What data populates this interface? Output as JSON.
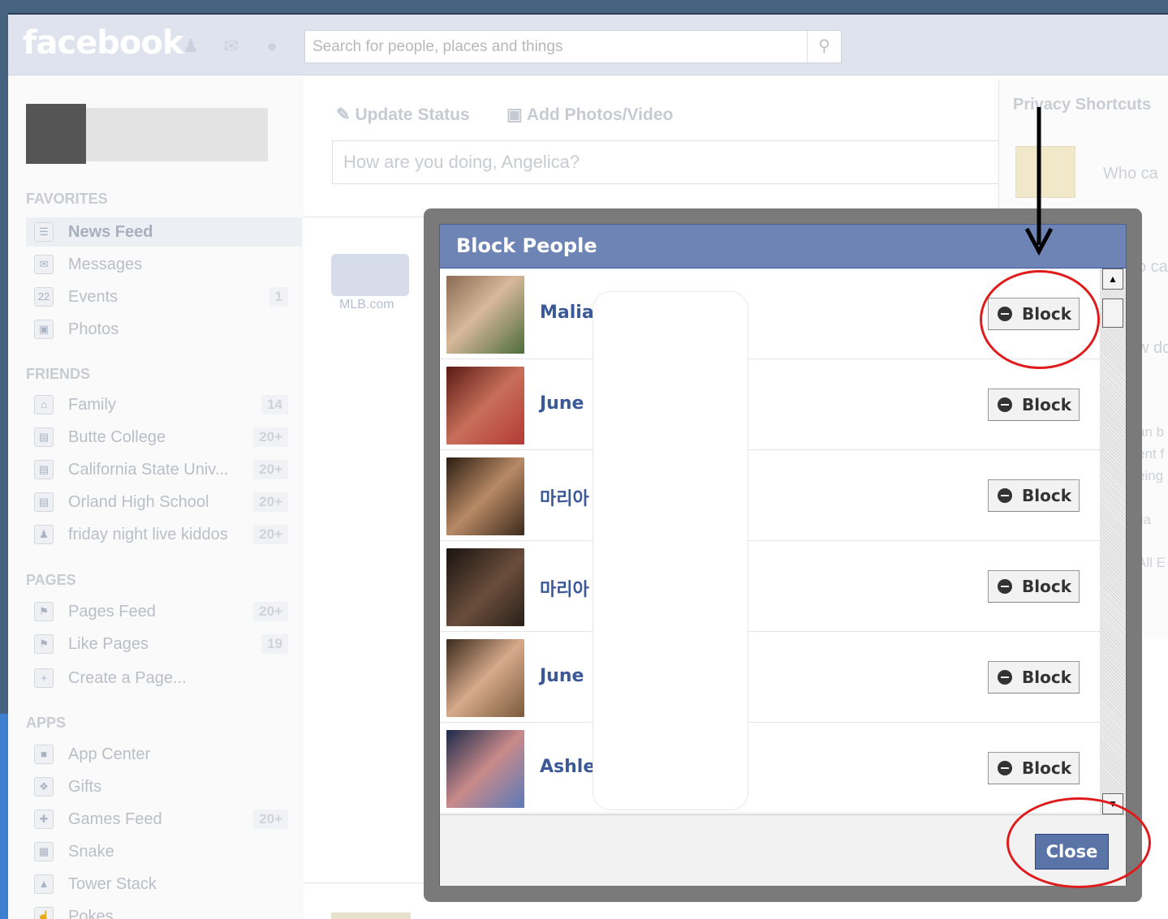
{
  "topbar": {
    "logo": "facebook",
    "search_placeholder": "Search for people, places and things"
  },
  "sidebar": {
    "favorites_header": "FAVORITES",
    "favorites": [
      {
        "label": "News Feed",
        "count": "",
        "icon": "news-feed-icon"
      },
      {
        "label": "Messages",
        "count": "",
        "icon": "messages-icon"
      },
      {
        "label": "Events",
        "count": "1",
        "icon": "events-icon"
      },
      {
        "label": "Photos",
        "count": "",
        "icon": "photos-icon"
      }
    ],
    "friends_header": "FRIENDS",
    "friends": [
      {
        "label": "Family",
        "count": "14"
      },
      {
        "label": "Butte College",
        "count": "20+"
      },
      {
        "label": "California State Univ...",
        "count": "20+"
      },
      {
        "label": "Orland High School",
        "count": "20+"
      },
      {
        "label": "friday night live kiddos",
        "count": "20+"
      }
    ],
    "pages_header": "PAGES",
    "pages": [
      {
        "label": "Pages Feed",
        "count": "20+"
      },
      {
        "label": "Like Pages",
        "count": "19"
      },
      {
        "label": "Create a Page...",
        "count": ""
      }
    ],
    "apps_header": "APPS",
    "apps": [
      {
        "label": "App Center",
        "count": ""
      },
      {
        "label": "Gifts",
        "count": ""
      },
      {
        "label": "Games Feed",
        "count": "20+"
      },
      {
        "label": "Snake",
        "count": ""
      },
      {
        "label": "Tower Stack",
        "count": ""
      },
      {
        "label": "Pokes",
        "count": ""
      }
    ]
  },
  "composer": {
    "update_status": "Update Status",
    "add_photos": "Add Photos/Video",
    "placeholder": "How are you doing, Angelica?"
  },
  "feed": {
    "mlb_label": "MLB.com"
  },
  "privacy": {
    "title": "Privacy Shortcuts",
    "line1": "Who ca",
    "line2": "o ca",
    "line3": "w do",
    "line4": "an b",
    "line5": "ent f",
    "line6": "eing",
    "line7": "lia",
    "line8": "All E"
  },
  "dialog": {
    "title": "Block People",
    "block_label": "Block",
    "close_label": "Close",
    "people": [
      {
        "name": "Malia"
      },
      {
        "name": "June"
      },
      {
        "name": "마리아"
      },
      {
        "name": "마리아"
      },
      {
        "name": "June"
      },
      {
        "name": "Ashle"
      }
    ]
  },
  "colors": {
    "header": "#6d84b4",
    "link": "#3b5998",
    "annotation": "#e01b1b"
  }
}
